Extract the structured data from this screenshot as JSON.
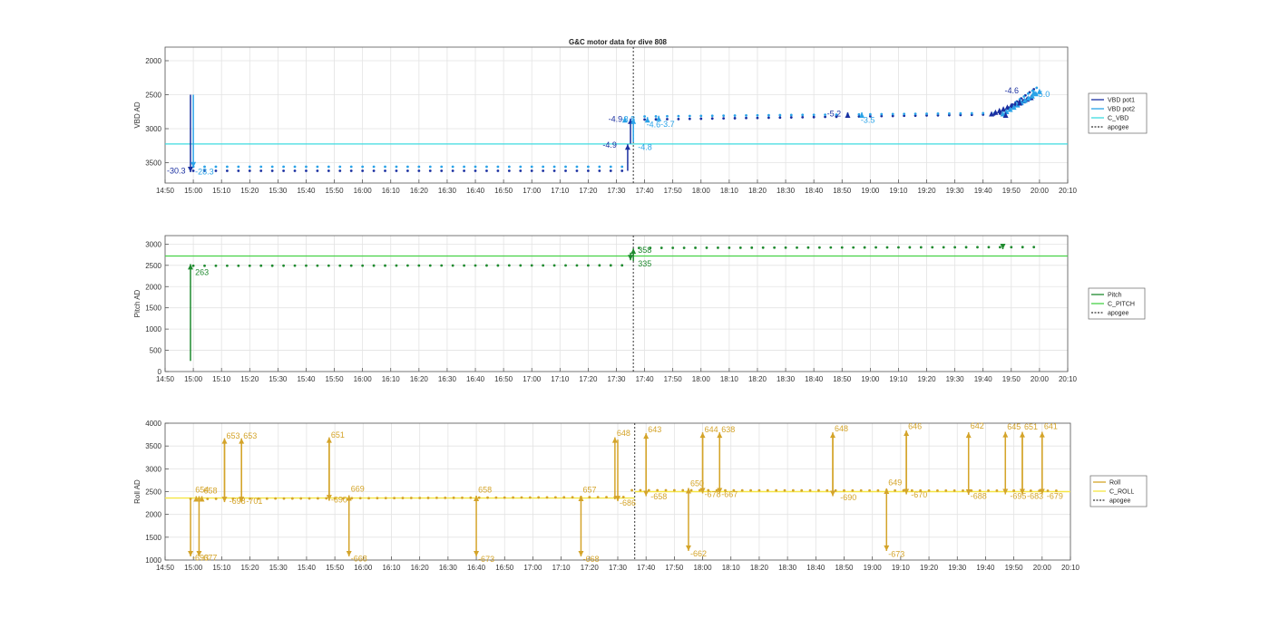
{
  "figure": {
    "title": "G&C motor data for dive 808"
  },
  "time_ticks": [
    "14:50",
    "15:00",
    "15:10",
    "15:20",
    "15:30",
    "15:40",
    "15:50",
    "16:00",
    "16:10",
    "16:20",
    "16:30",
    "16:40",
    "16:50",
    "17:00",
    "17:10",
    "17:20",
    "17:30",
    "17:40",
    "17:50",
    "18:00",
    "18:10",
    "18:20",
    "18:30",
    "18:40",
    "18:50",
    "19:00",
    "19:10",
    "19:20",
    "19:30",
    "19:40",
    "19:50",
    "20:00",
    "20:10"
  ],
  "chart_data": [
    {
      "type": "scatter",
      "title": "G&C motor data for dive 808",
      "xlabel": "",
      "ylabel": "VBD AD",
      "xlim": [
        "14:50",
        "20:10"
      ],
      "ylim": [
        3800,
        1800
      ],
      "y_reversed": true,
      "yticks": [
        2000,
        2500,
        3000,
        3500
      ],
      "grid": true,
      "legend_placement": "outside-right",
      "legend": [
        "VBD pot1",
        "VBD pot2",
        "C_VBD",
        "apogee"
      ],
      "colors": {
        "pot1": "#1a2fa0",
        "pot2": "#2aa3e8",
        "c_line": "#3ddbe0",
        "apogee": "#444444"
      },
      "series": [
        {
          "name": "VBD pot1",
          "segments": [
            {
              "t": [
                "15:00",
                "17:33"
              ],
              "v": [
                3620,
                3620
              ],
              "step": 4
            },
            {
              "t": [
                "17:40",
                "19:46"
              ],
              "v": [
                2865,
                2790
              ],
              "step": 4
            },
            {
              "t": [
                "19:46",
                "19:58"
              ],
              "v": [
                2780,
                2420
              ],
              "step": 1.5
            }
          ]
        },
        {
          "name": "VBD pot2",
          "segments": [
            {
              "t": [
                "15:00",
                "17:33"
              ],
              "v": [
                3560,
                3560
              ],
              "step": 4
            },
            {
              "t": [
                "17:40",
                "19:46"
              ],
              "v": [
                2820,
                2770
              ],
              "step": 4
            },
            {
              "t": [
                "19:47",
                "20:00"
              ],
              "v": [
                2740,
                2370
              ],
              "step": 1.5
            }
          ]
        }
      ],
      "c_value": 3225,
      "apogee": "17:36",
      "arrows": [
        {
          "t": "14:59",
          "from": 2500,
          "to": 3640,
          "color": "#1a2fa0",
          "label": "-30.3",
          "lt": "14:50",
          "lv": 3660,
          "anchor": "start"
        },
        {
          "t": "15:00",
          "from": 2500,
          "to": 3570,
          "color": "#2aa3e8",
          "label": "-28.3",
          "lt": "15:00",
          "lv": 3670,
          "anchor": "start"
        },
        {
          "t": "17:34",
          "from": 3620,
          "to": 3230,
          "color": "#1a2fa0",
          "label": "-4.9",
          "lt": "17:27",
          "lv": 3280,
          "anchor": "middle"
        },
        {
          "t": "17:35",
          "from": 3220,
          "to": 2850,
          "color": "#1a2fa0",
          "label": "-4.9",
          "lt": "17:29",
          "lv": 2900,
          "anchor": "middle"
        },
        {
          "t": "17:36",
          "from": 3200,
          "to": 2850,
          "color": "#2aa3e8",
          "label": "-4.8",
          "lt": "17:37",
          "lv": 3310,
          "anchor": "start"
        },
        {
          "t": "17:41",
          "from": 2900,
          "to": 2830,
          "color": "#2aa3e8",
          "label": "-4.6",
          "lt": "17:40",
          "lv": 2980,
          "anchor": "start"
        },
        {
          "t": "17:45",
          "from": 2870,
          "to": 2810,
          "color": "#2aa3e8",
          "label": "-3.7",
          "lt": "17:45",
          "lv": 2970,
          "anchor": "start"
        },
        {
          "t": "17:33",
          "from": 2880,
          "to": 2830,
          "color": "#2aa3e8",
          "label": "-3.8",
          "lt": "17:31",
          "lv": 2900,
          "anchor": "start"
        },
        {
          "t": "18:52",
          "from": 2830,
          "to": 2760,
          "color": "#1a2fa0",
          "label": "-5.2",
          "lt": "18:44",
          "lv": 2820,
          "anchor": "start"
        },
        {
          "t": "18:57",
          "from": 2840,
          "to": 2760,
          "color": "#2aa3e8",
          "label": "-3.5",
          "lt": "18:56",
          "lv": 2910,
          "anchor": "start"
        },
        {
          "t": "19:48",
          "from": 2800,
          "to": 2760,
          "color": "#1a2fa0",
          "label": "-4.6",
          "lt": "19:47",
          "lv": 2480,
          "anchor": "start"
        },
        {
          "t": "19:53",
          "from": 2650,
          "to": 2580,
          "color": "#1a2fa0",
          "label": "",
          "lt": "19:53",
          "lv": 2600,
          "anchor": "start"
        },
        {
          "t": "19:58",
          "from": 2500,
          "to": 2430,
          "color": "#2aa3e8",
          "label": "-5.0",
          "lt": "19:58",
          "lv": 2530,
          "anchor": "start"
        }
      ],
      "clusters": [
        {
          "t0": "19:43",
          "t1": "19:57",
          "v0": 2780,
          "v1": 2540,
          "color": "#1a2fa0"
        },
        {
          "t0": "19:47",
          "t1": "20:00",
          "v0": 2780,
          "v1": 2450,
          "color": "#2aa3e8"
        }
      ]
    },
    {
      "type": "scatter",
      "title": "",
      "xlabel": "",
      "ylabel": "Pitch AD",
      "xlim": [
        "14:50",
        "20:10"
      ],
      "ylim": [
        0,
        3200
      ],
      "yticks": [
        0,
        500,
        1000,
        1500,
        2000,
        2500,
        3000
      ],
      "grid": true,
      "legend_placement": "outside-right",
      "legend": [
        "Pitch",
        "C_PITCH",
        "apogee"
      ],
      "colors": {
        "main": "#1e8a2e",
        "c_line": "#46d146",
        "apogee": "#444444"
      },
      "series": [
        {
          "name": "Pitch",
          "segments": [
            {
              "t": [
                "15:00",
                "17:32"
              ],
              "v": [
                2490,
                2500
              ],
              "step": 4
            },
            {
              "t": [
                "17:38",
                "20:00"
              ],
              "v": [
                2910,
                2930
              ],
              "step": 4
            }
          ]
        }
      ],
      "c_value": 2720,
      "apogee": "17:36",
      "arrows": [
        {
          "t": "14:59",
          "from": 250,
          "to": 2530,
          "color": "#1e8a2e",
          "label": "263",
          "lt": "15:00",
          "lv": 2270,
          "anchor": "start"
        },
        {
          "t": "17:36",
          "from": 2600,
          "to": 2900,
          "color": "#1e8a2e",
          "label": "358",
          "lt": "17:37",
          "lv": 2800,
          "anchor": "start"
        },
        {
          "t": "17:35",
          "from": 2800,
          "to": 2620,
          "color": "#1e8a2e",
          "label": "335",
          "lt": "17:37",
          "lv": 2480,
          "anchor": "start"
        },
        {
          "t": "19:47",
          "from": 2950,
          "to": 2880,
          "color": "#1e8a2e",
          "label": "",
          "lt": "19:47",
          "lv": 2900,
          "anchor": "start"
        }
      ]
    },
    {
      "type": "scatter",
      "title": "",
      "xlabel": "",
      "ylabel": "Roll AD",
      "xlim": [
        "14:50",
        "20:10"
      ],
      "ylim": [
        1000,
        4000
      ],
      "yticks": [
        1000,
        1500,
        2000,
        2500,
        3000,
        3500,
        4000
      ],
      "grid": true,
      "legend_placement": "outside-right",
      "legend": [
        "Roll",
        "C_ROLL",
        "apogee"
      ],
      "colors": {
        "main": "#d4a42a",
        "c_line": "#f5e642",
        "apogee": "#444444"
      },
      "series": [
        {
          "name": "Roll",
          "segments": [
            {
              "t": [
                "14:59",
                "17:32"
              ],
              "v": [
                2340,
                2380
              ],
              "step": 3
            },
            {
              "t": [
                "17:35",
                "20:05"
              ],
              "v": [
                2530,
                2520
              ],
              "step": 3
            }
          ]
        }
      ],
      "c_value_left": 2360,
      "c_value_right": 2500,
      "c_split": "17:36",
      "apogee": "17:36",
      "arrows": [
        {
          "t": "14:59",
          "from": 2340,
          "to": 1080,
          "color": "#d4a42a",
          "label": "-693",
          "lt": "14:59",
          "lv": 990,
          "anchor": "start"
        },
        {
          "t": "15:01",
          "from": 2330,
          "to": 2400,
          "color": "#d4a42a",
          "label": "654",
          "lt": "15:00",
          "lv": 2480,
          "anchor": "start"
        },
        {
          "t": "15:02",
          "from": 2400,
          "to": 1080,
          "color": "#d4a42a",
          "label": "-677",
          "lt": "15:02",
          "lv": 990,
          "anchor": "start"
        },
        {
          "t": "15:03",
          "from": 2330,
          "to": 2400,
          "color": "#d4a42a",
          "label": "658",
          "lt": "15:03",
          "lv": 2460,
          "anchor": "start"
        },
        {
          "t": "15:11",
          "from": 2300,
          "to": 3670,
          "color": "#d4a42a",
          "label": "653",
          "lt": "15:11",
          "lv": 3660,
          "anchor": "start"
        },
        {
          "t": "15:11",
          "from": 3630,
          "to": 2270,
          "color": "#d4a42a",
          "label": "-698",
          "lt": "15:12",
          "lv": 2230,
          "anchor": "start"
        },
        {
          "t": "15:17",
          "from": 2300,
          "to": 3670,
          "color": "#d4a42a",
          "label": "653",
          "lt": "15:17",
          "lv": 3660,
          "anchor": "start"
        },
        {
          "t": "15:17",
          "from": 3630,
          "to": 2270,
          "color": "#d4a42a",
          "label": "-701",
          "lt": "15:18",
          "lv": 2230,
          "anchor": "start"
        },
        {
          "t": "15:48",
          "from": 2300,
          "to": 3690,
          "color": "#d4a42a",
          "label": "651",
          "lt": "15:48",
          "lv": 3680,
          "anchor": "start"
        },
        {
          "t": "15:48",
          "from": 3650,
          "to": 2310,
          "color": "#d4a42a",
          "label": "-690",
          "lt": "15:48",
          "lv": 2260,
          "anchor": "start"
        },
        {
          "t": "15:55",
          "from": 2310,
          "to": 2420,
          "color": "#d4a42a",
          "label": "669",
          "lt": "15:55",
          "lv": 2500,
          "anchor": "start"
        },
        {
          "t": "15:55",
          "from": 2400,
          "to": 1080,
          "color": "#d4a42a",
          "label": "-668",
          "lt": "15:55",
          "lv": 970,
          "anchor": "start"
        },
        {
          "t": "16:40",
          "from": 2330,
          "to": 2410,
          "color": "#d4a42a",
          "label": "658",
          "lt": "16:40",
          "lv": 2480,
          "anchor": "start"
        },
        {
          "t": "16:40",
          "from": 2400,
          "to": 1080,
          "color": "#d4a42a",
          "label": "-673",
          "lt": "16:40",
          "lv": 960,
          "anchor": "start"
        },
        {
          "t": "17:17",
          "from": 2330,
          "to": 2410,
          "color": "#d4a42a",
          "label": "657",
          "lt": "17:17",
          "lv": 2480,
          "anchor": "start"
        },
        {
          "t": "17:17",
          "from": 2400,
          "to": 1080,
          "color": "#d4a42a",
          "label": "-668",
          "lt": "17:17",
          "lv": 960,
          "anchor": "start"
        },
        {
          "t": "17:29",
          "from": 2330,
          "to": 3690,
          "color": "#d4a42a",
          "label": "648",
          "lt": "17:29",
          "lv": 3720,
          "anchor": "start"
        },
        {
          "t": "17:30",
          "from": 3640,
          "to": 2290,
          "color": "#d4a42a",
          "label": "-686",
          "lt": "17:30",
          "lv": 2190,
          "anchor": "start"
        },
        {
          "t": "17:40",
          "from": 2480,
          "to": 3780,
          "color": "#d4a42a",
          "label": "643",
          "lt": "17:40",
          "lv": 3800,
          "anchor": "start"
        },
        {
          "t": "17:40",
          "from": 3740,
          "to": 2400,
          "color": "#d4a42a",
          "label": "-658",
          "lt": "17:41",
          "lv": 2330,
          "anchor": "start"
        },
        {
          "t": "17:55",
          "from": 2500,
          "to": 2580,
          "color": "#d4a42a",
          "label": "650",
          "lt": "17:55",
          "lv": 2620,
          "anchor": "start"
        },
        {
          "t": "17:55",
          "from": 2560,
          "to": 1200,
          "color": "#d4a42a",
          "label": "-662",
          "lt": "17:55",
          "lv": 1080,
          "anchor": "start"
        },
        {
          "t": "18:00",
          "from": 2490,
          "to": 3800,
          "color": "#d4a42a",
          "label": "644",
          "lt": "18:00",
          "lv": 3800,
          "anchor": "start"
        },
        {
          "t": "18:00",
          "from": 3760,
          "to": 2460,
          "color": "#d4a42a",
          "label": "-678",
          "lt": "18:00",
          "lv": 2380,
          "anchor": "start"
        },
        {
          "t": "18:06",
          "from": 2490,
          "to": 3800,
          "color": "#d4a42a",
          "label": "638",
          "lt": "18:06",
          "lv": 3800,
          "anchor": "start"
        },
        {
          "t": "18:06",
          "from": 3760,
          "to": 2460,
          "color": "#d4a42a",
          "label": "-667",
          "lt": "18:06",
          "lv": 2380,
          "anchor": "start"
        },
        {
          "t": "18:46",
          "from": 2490,
          "to": 3800,
          "color": "#d4a42a",
          "label": "648",
          "lt": "18:46",
          "lv": 3820,
          "anchor": "start"
        },
        {
          "t": "18:46",
          "from": 3760,
          "to": 2400,
          "color": "#d4a42a",
          "label": "-690",
          "lt": "18:48",
          "lv": 2310,
          "anchor": "start"
        },
        {
          "t": "19:05",
          "from": 2490,
          "to": 2570,
          "color": "#d4a42a",
          "label": "649",
          "lt": "19:05",
          "lv": 2640,
          "anchor": "start"
        },
        {
          "t": "19:05",
          "from": 2560,
          "to": 1200,
          "color": "#d4a42a",
          "label": "-673",
          "lt": "19:05",
          "lv": 1070,
          "anchor": "start"
        },
        {
          "t": "19:12",
          "from": 2500,
          "to": 3840,
          "color": "#d4a42a",
          "label": "646",
          "lt": "19:12",
          "lv": 3870,
          "anchor": "start"
        },
        {
          "t": "19:12",
          "from": 3800,
          "to": 2440,
          "color": "#d4a42a",
          "label": "-670",
          "lt": "19:13",
          "lv": 2370,
          "anchor": "start"
        },
        {
          "t": "19:34",
          "from": 2510,
          "to": 3800,
          "color": "#d4a42a",
          "label": "642",
          "lt": "19:34",
          "lv": 3880,
          "anchor": "start"
        },
        {
          "t": "19:34",
          "from": 3760,
          "to": 2430,
          "color": "#d4a42a",
          "label": "-688",
          "lt": "19:34",
          "lv": 2340,
          "anchor": "start"
        },
        {
          "t": "19:47",
          "from": 2510,
          "to": 3810,
          "color": "#d4a42a",
          "label": "645",
          "lt": "19:47",
          "lv": 3860,
          "anchor": "start"
        },
        {
          "t": "19:47",
          "from": 3770,
          "to": 2440,
          "color": "#d4a42a",
          "label": "-695",
          "lt": "19:48",
          "lv": 2340,
          "anchor": "start"
        },
        {
          "t": "19:53",
          "from": 2510,
          "to": 3810,
          "color": "#d4a42a",
          "label": "651",
          "lt": "19:53",
          "lv": 3860,
          "anchor": "start"
        },
        {
          "t": "19:53",
          "from": 3770,
          "to": 2440,
          "color": "#d4a42a",
          "label": "-683",
          "lt": "19:54",
          "lv": 2340,
          "anchor": "start"
        },
        {
          "t": "20:00",
          "from": 2510,
          "to": 3810,
          "color": "#d4a42a",
          "label": "641",
          "lt": "20:00",
          "lv": 3870,
          "anchor": "start"
        },
        {
          "t": "20:00",
          "from": 3770,
          "to": 2440,
          "color": "#d4a42a",
          "label": "-679",
          "lt": "20:01",
          "lv": 2340,
          "anchor": "start"
        }
      ]
    }
  ]
}
